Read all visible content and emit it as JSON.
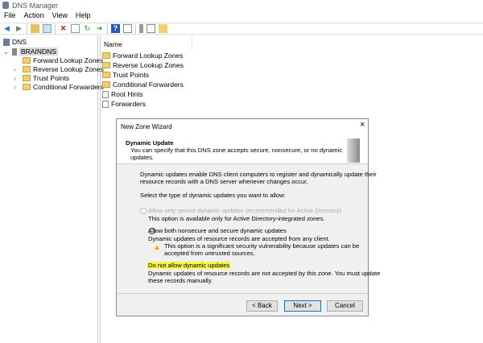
{
  "window": {
    "title": "DNS Manager"
  },
  "menu": [
    "File",
    "Action",
    "View",
    "Help"
  ],
  "tree": {
    "root": "DNS",
    "server": "BRAINDNS",
    "children": [
      "Forward Lookup Zones",
      "Reverse Lookup Zones",
      "Trust Points",
      "Conditional Forwarders"
    ]
  },
  "list": {
    "header": "Name",
    "items": [
      "Forward Lookup Zones",
      "Reverse Lookup Zones",
      "Trust Points",
      "Conditional Forwarders",
      "Root Hints",
      "Forwarders"
    ]
  },
  "dialog": {
    "title": "New Zone Wizard",
    "heading": "Dynamic Update",
    "subheading_1": "You can specify that this DNS zone accepts secure, nonsecure, or no dynamic",
    "subheading_2": "updates.",
    "intro_1": "Dynamic updates enable DNS client computers to register and dynamically update their",
    "intro_2": "resource records with a DNS server whenever changes occur.",
    "prompt": "Select the type of dynamic updates you want to allow:",
    "options": [
      {
        "label": "Allow only secure dynamic updates (recommended for Active Directory)",
        "desc_1": "This option is available only for Active Directory-integrated zones.",
        "disabled": true,
        "selected": false
      },
      {
        "label": "Allow both nonsecure and secure dynamic updates",
        "desc_1": "Dynamic updates of resource records are accepted from any client.",
        "warning_1": "This option is a significant security vulnerability because updates can be",
        "warning_2": "accepted from untrusted sources.",
        "selected": false
      },
      {
        "label": "Do not allow dynamic updates",
        "desc_1": "Dynamic updates of resource records are not accepted by this zone. You must update",
        "desc_2": "these records manually.",
        "selected": true
      }
    ],
    "buttons": {
      "back": "< Back",
      "next": "Next >",
      "cancel": "Cancel"
    },
    "close": "×"
  },
  "colors": {
    "highlight": "#f5f542",
    "accent": "#0078d7"
  }
}
